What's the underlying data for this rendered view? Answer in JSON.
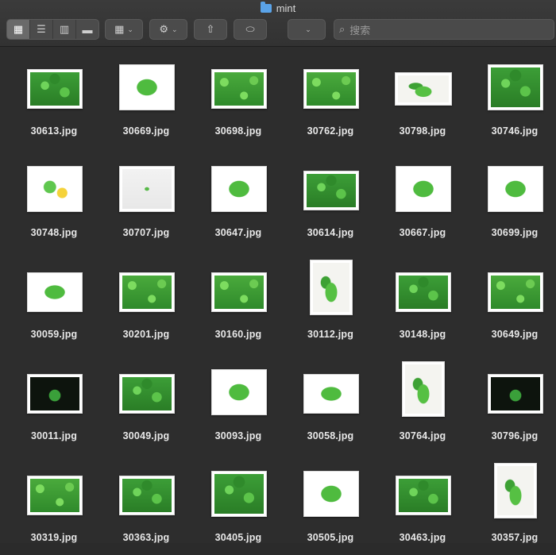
{
  "window": {
    "title": "mint"
  },
  "toolbar": {
    "view_buttons": [
      {
        "name": "icon-view-button",
        "icon": "grid-icon",
        "glyph": "▦",
        "active": true
      },
      {
        "name": "list-view-button",
        "icon": "list-icon",
        "glyph": "☰",
        "active": false
      },
      {
        "name": "column-view-button",
        "icon": "columns-icon",
        "glyph": "▥",
        "active": false
      },
      {
        "name": "gallery-view-button",
        "icon": "gallery-icon",
        "glyph": "▬",
        "active": false
      }
    ],
    "group_glyph": "▦",
    "action_glyph": "⚙",
    "share_glyph": "⇧",
    "tag_glyph": "⬭",
    "chevron_glyph": "⌄",
    "search": {
      "placeholder": "搜索",
      "icon_glyph": "🔍"
    }
  },
  "files": [
    {
      "name": "30613.jpg",
      "variant": "v1",
      "shape": "landscape"
    },
    {
      "name": "30669.jpg",
      "variant": "v2",
      "shape": "square"
    },
    {
      "name": "30698.jpg",
      "variant": "v3",
      "shape": "landscape"
    },
    {
      "name": "30762.jpg",
      "variant": "v3",
      "shape": "landscape"
    },
    {
      "name": "30798.jpg",
      "variant": "v4",
      "shape": "wide"
    },
    {
      "name": "30746.jpg",
      "variant": "v1",
      "shape": "square"
    },
    {
      "name": "30748.jpg",
      "variant": "v7",
      "shape": "square"
    },
    {
      "name": "30707.jpg",
      "variant": "v6",
      "shape": "square"
    },
    {
      "name": "30647.jpg",
      "variant": "v2",
      "shape": "square"
    },
    {
      "name": "30614.jpg",
      "variant": "v1",
      "shape": "landscape"
    },
    {
      "name": "30667.jpg",
      "variant": "v2",
      "shape": "square"
    },
    {
      "name": "30699.jpg",
      "variant": "v2",
      "shape": "square"
    },
    {
      "name": "30059.jpg",
      "variant": "v2",
      "shape": "landscape"
    },
    {
      "name": "30201.jpg",
      "variant": "v3",
      "shape": "landscape"
    },
    {
      "name": "30160.jpg",
      "variant": "v3",
      "shape": "landscape"
    },
    {
      "name": "30112.jpg",
      "variant": "v4",
      "shape": "portrait"
    },
    {
      "name": "30148.jpg",
      "variant": "v1",
      "shape": "landscape"
    },
    {
      "name": "30649.jpg",
      "variant": "v3",
      "shape": "landscape"
    },
    {
      "name": "30011.jpg",
      "variant": "v5",
      "shape": "landscape"
    },
    {
      "name": "30049.jpg",
      "variant": "v1",
      "shape": "landscape"
    },
    {
      "name": "30093.jpg",
      "variant": "v2",
      "shape": "square"
    },
    {
      "name": "30058.jpg",
      "variant": "v2",
      "shape": "landscape"
    },
    {
      "name": "30764.jpg",
      "variant": "v4",
      "shape": "portrait"
    },
    {
      "name": "30796.jpg",
      "variant": "v5",
      "shape": "landscape"
    },
    {
      "name": "30319.jpg",
      "variant": "v3",
      "shape": "landscape"
    },
    {
      "name": "30363.jpg",
      "variant": "v1",
      "shape": "landscape"
    },
    {
      "name": "30405.jpg",
      "variant": "v1",
      "shape": "square"
    },
    {
      "name": "30505.jpg",
      "variant": "v2",
      "shape": "square"
    },
    {
      "name": "30463.jpg",
      "variant": "v1",
      "shape": "landscape"
    },
    {
      "name": "30357.jpg",
      "variant": "v4",
      "shape": "portrait"
    }
  ]
}
